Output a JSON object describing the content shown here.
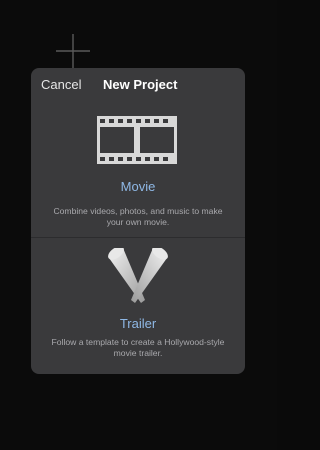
{
  "background": {
    "add_icon": "plus-icon"
  },
  "sheet": {
    "cancel_label": "Cancel",
    "title": "New Project",
    "options": [
      {
        "icon": "film-strip-icon",
        "label": "Movie",
        "description": "Combine videos, photos, and music to make your own movie."
      },
      {
        "icon": "spotlights-icon",
        "label": "Trailer",
        "description": "Follow a template to create a Hollywood-style movie trailer."
      }
    ]
  },
  "colors": {
    "sheet_background": "#3a3a3c",
    "label_accent": "#8fb8e6",
    "description_text": "#a9a9ad"
  }
}
